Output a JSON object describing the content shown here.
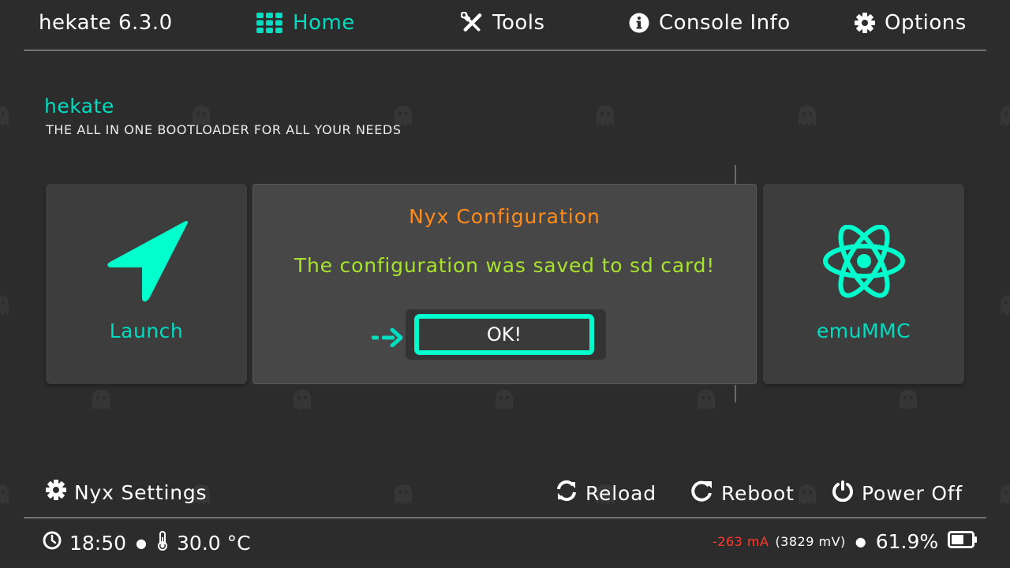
{
  "header": {
    "app_version": "hekate 6.3.0",
    "nav": [
      {
        "label": "Home",
        "icon": "apps-grid-icon",
        "active": true
      },
      {
        "label": "Tools",
        "icon": "tools-icon"
      },
      {
        "label": "Console Info",
        "icon": "info-icon"
      },
      {
        "label": "Options",
        "icon": "gear-icon"
      }
    ]
  },
  "main": {
    "heading": "hekate",
    "subheading": "THE ALL IN ONE BOOTLOADER FOR ALL YOUR NEEDS",
    "tiles": [
      {
        "label": "Launch",
        "icon": "navigation-arrow-icon"
      },
      {
        "label": "emuMMC",
        "icon": "atom-icon"
      }
    ]
  },
  "dialog": {
    "title": "Nyx Configuration",
    "message": "The configuration was saved to sd card!",
    "ok_label": "OK!"
  },
  "footer": {
    "settings_label": "Nyx Settings",
    "reload_label": "Reload",
    "reboot_label": "Reboot",
    "poweroff_label": "Power Off"
  },
  "status": {
    "time": "18:50",
    "temperature": "30.0 °C",
    "current": "-263 mA",
    "voltage": "(3829 mV)",
    "battery": "61.9%",
    "battery_level": 0.619
  },
  "colors": {
    "accent": "#00ddc0",
    "ok_border": "#00ffcc",
    "title_orange": "#ff8c1a",
    "message_green": "#a6e22e",
    "current_red": "#ff3b30",
    "background": "#2c2c2c"
  }
}
